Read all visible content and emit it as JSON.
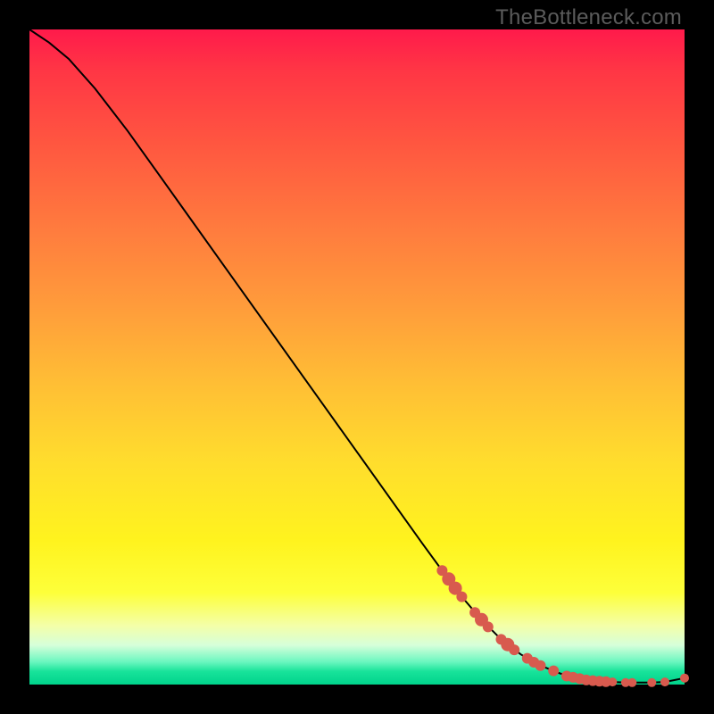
{
  "watermark": "TheBottleneck.com",
  "chart_data": {
    "type": "line",
    "title": "",
    "xlabel": "",
    "ylabel": "",
    "xlim": [
      0,
      100
    ],
    "ylim": [
      0,
      100
    ],
    "grid": false,
    "series": [
      {
        "name": "curve",
        "x": [
          0,
          3,
          6,
          10,
          15,
          20,
          25,
          30,
          35,
          40,
          45,
          50,
          55,
          60,
          63,
          66,
          69,
          72,
          75,
          78,
          81,
          83,
          85,
          87,
          89,
          91,
          93,
          95,
          97,
          100
        ],
        "values": [
          100,
          98,
          95.5,
          91,
          84.5,
          77.5,
          70.5,
          63.5,
          56.5,
          49.5,
          42.5,
          35.5,
          28.5,
          21.5,
          17.4,
          13.4,
          9.9,
          6.9,
          4.6,
          2.9,
          1.7,
          1.1,
          0.7,
          0.5,
          0.4,
          0.3,
          0.3,
          0.3,
          0.4,
          1.0
        ]
      }
    ],
    "markers": [
      {
        "x": 63,
        "y": 17.4,
        "r": 6
      },
      {
        "x": 64,
        "y": 16.1,
        "r": 7.5
      },
      {
        "x": 65,
        "y": 14.7,
        "r": 7.5
      },
      {
        "x": 66,
        "y": 13.4,
        "r": 6
      },
      {
        "x": 68,
        "y": 11.0,
        "r": 6
      },
      {
        "x": 69,
        "y": 9.9,
        "r": 7.5
      },
      {
        "x": 70,
        "y": 8.8,
        "r": 6
      },
      {
        "x": 72,
        "y": 6.9,
        "r": 6
      },
      {
        "x": 73,
        "y": 6.1,
        "r": 7.5
      },
      {
        "x": 74,
        "y": 5.3,
        "r": 6
      },
      {
        "x": 76,
        "y": 4.0,
        "r": 6
      },
      {
        "x": 77,
        "y": 3.4,
        "r": 6
      },
      {
        "x": 78,
        "y": 2.9,
        "r": 6
      },
      {
        "x": 80,
        "y": 2.1,
        "r": 6
      },
      {
        "x": 82,
        "y": 1.3,
        "r": 6
      },
      {
        "x": 83,
        "y": 1.1,
        "r": 6
      },
      {
        "x": 84,
        "y": 0.9,
        "r": 6
      },
      {
        "x": 85,
        "y": 0.7,
        "r": 6
      },
      {
        "x": 86,
        "y": 0.6,
        "r": 6
      },
      {
        "x": 87,
        "y": 0.5,
        "r": 6
      },
      {
        "x": 88,
        "y": 0.45,
        "r": 6
      },
      {
        "x": 89,
        "y": 0.4,
        "r": 5
      },
      {
        "x": 91,
        "y": 0.3,
        "r": 5
      },
      {
        "x": 92,
        "y": 0.3,
        "r": 5
      },
      {
        "x": 95,
        "y": 0.3,
        "r": 5
      },
      {
        "x": 97,
        "y": 0.4,
        "r": 5
      },
      {
        "x": 100,
        "y": 1.0,
        "r": 5
      }
    ]
  },
  "colors": {
    "marker": "#d85a4e",
    "line": "#000000"
  }
}
